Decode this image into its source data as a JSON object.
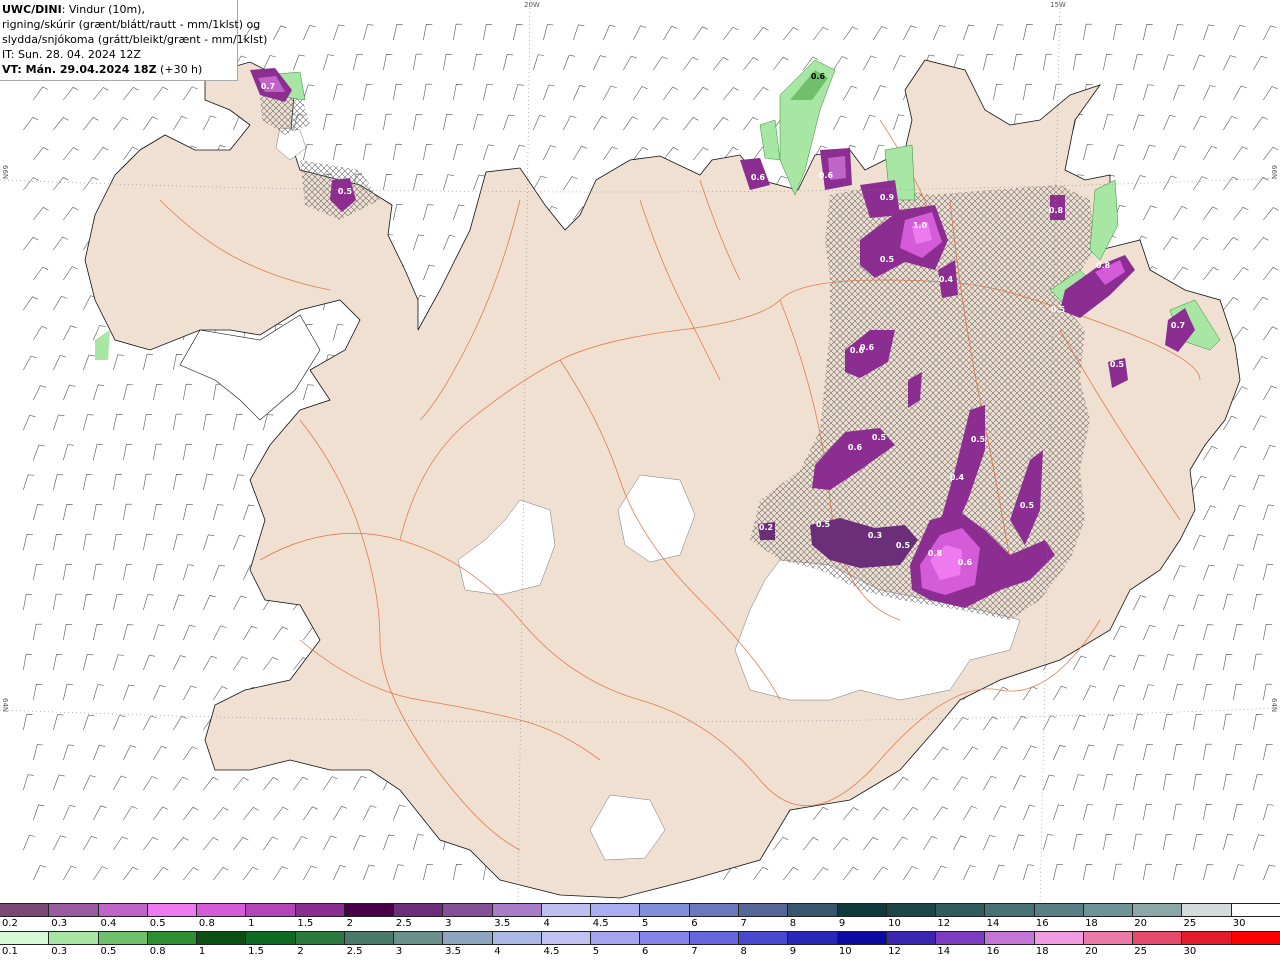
{
  "header": {
    "model": "UWC/DINI",
    "line1_rest": ": Vindur (10m),",
    "line2": "rigning/skúrir (grænt/blátt/rautt - mm/1klst) og",
    "line3": "slydda/snjókoma (grátt/bleikt/grænt - mm/1klst)",
    "init_time": "IT: Sun. 28. 04. 2024 12Z",
    "valid_label": "VT: Mán. 29.04.2024 18Z",
    "valid_offset": " (+30 h)"
  },
  "map_labels": {
    "lon_20w": "20W",
    "lon_15w": "15W",
    "lat_66n_left": "66N",
    "lat_66n_right": "66N",
    "lat_64n_left": "64N",
    "lat_64n_right": "64N"
  },
  "value_labels": [
    "0.6",
    "0.7",
    "0.5",
    "0.6",
    "0.6",
    "0.6",
    "0.9",
    "1.0",
    "0.5",
    "0.4",
    "0.8",
    "0.5",
    "0.7",
    "0.6",
    "0.8",
    "0.5",
    "0.6",
    "0.5",
    "0.5",
    "0.4",
    "0.5",
    "0.5",
    "0.3",
    "0.8",
    "0.6",
    "0.5",
    "0.2"
  ],
  "snow_scale": {
    "labels": [
      "0.2",
      "0.3",
      "0.4",
      "0.5",
      "0.8",
      "1",
      "1.5",
      "2",
      "2.5",
      "3",
      "3.5",
      "4",
      "4.5",
      "5",
      "6",
      "7",
      "8",
      "9",
      "10",
      "12",
      "14",
      "16",
      "18",
      "20",
      "25",
      "30"
    ],
    "colors": [
      "#7a4a74",
      "#9a5aa0",
      "#c065c8",
      "#ee7af0",
      "#d55cd8",
      "#b445b8",
      "#8c2e91",
      "#4a0048",
      "#6a2f78",
      "#84509a",
      "#a87cc8",
      "#bfbff2",
      "#a9aef0",
      "#7f90dc",
      "#6b78bb",
      "#546798",
      "#38566e",
      "#0e3a3c",
      "#1c4748",
      "#305c5d",
      "#477173",
      "#587f86",
      "#6f9496",
      "#8ba7a8",
      "#d3dcdb",
      "#ffffff"
    ]
  },
  "rain_scale": {
    "labels": [
      "0.1",
      "0.3",
      "0.5",
      "0.8",
      "1",
      "1.5",
      "2",
      "2.5",
      "3",
      "3.5",
      "4",
      "4.5",
      "5",
      "6",
      "7",
      "8",
      "9",
      "10",
      "12",
      "14",
      "16",
      "18",
      "20",
      "25",
      "30"
    ],
    "colors": [
      "#d8f7d5",
      "#a8e6a3",
      "#6fbf6c",
      "#2d8f32",
      "#0b4f12",
      "#0f6b23",
      "#2a7a3d",
      "#4a7a6a",
      "#6b8f8a",
      "#8fa5bf",
      "#a9b9e3",
      "#c2c2f2",
      "#a4a4ef",
      "#8484e8",
      "#6565dd",
      "#4848cf",
      "#2727b8",
      "#0b0ba4",
      "#3a25b0",
      "#7b3bc2",
      "#c475d8",
      "#f19ce0",
      "#ea7aa6",
      "#e44a6a",
      "#e31b2c",
      "#ff0000"
    ]
  }
}
